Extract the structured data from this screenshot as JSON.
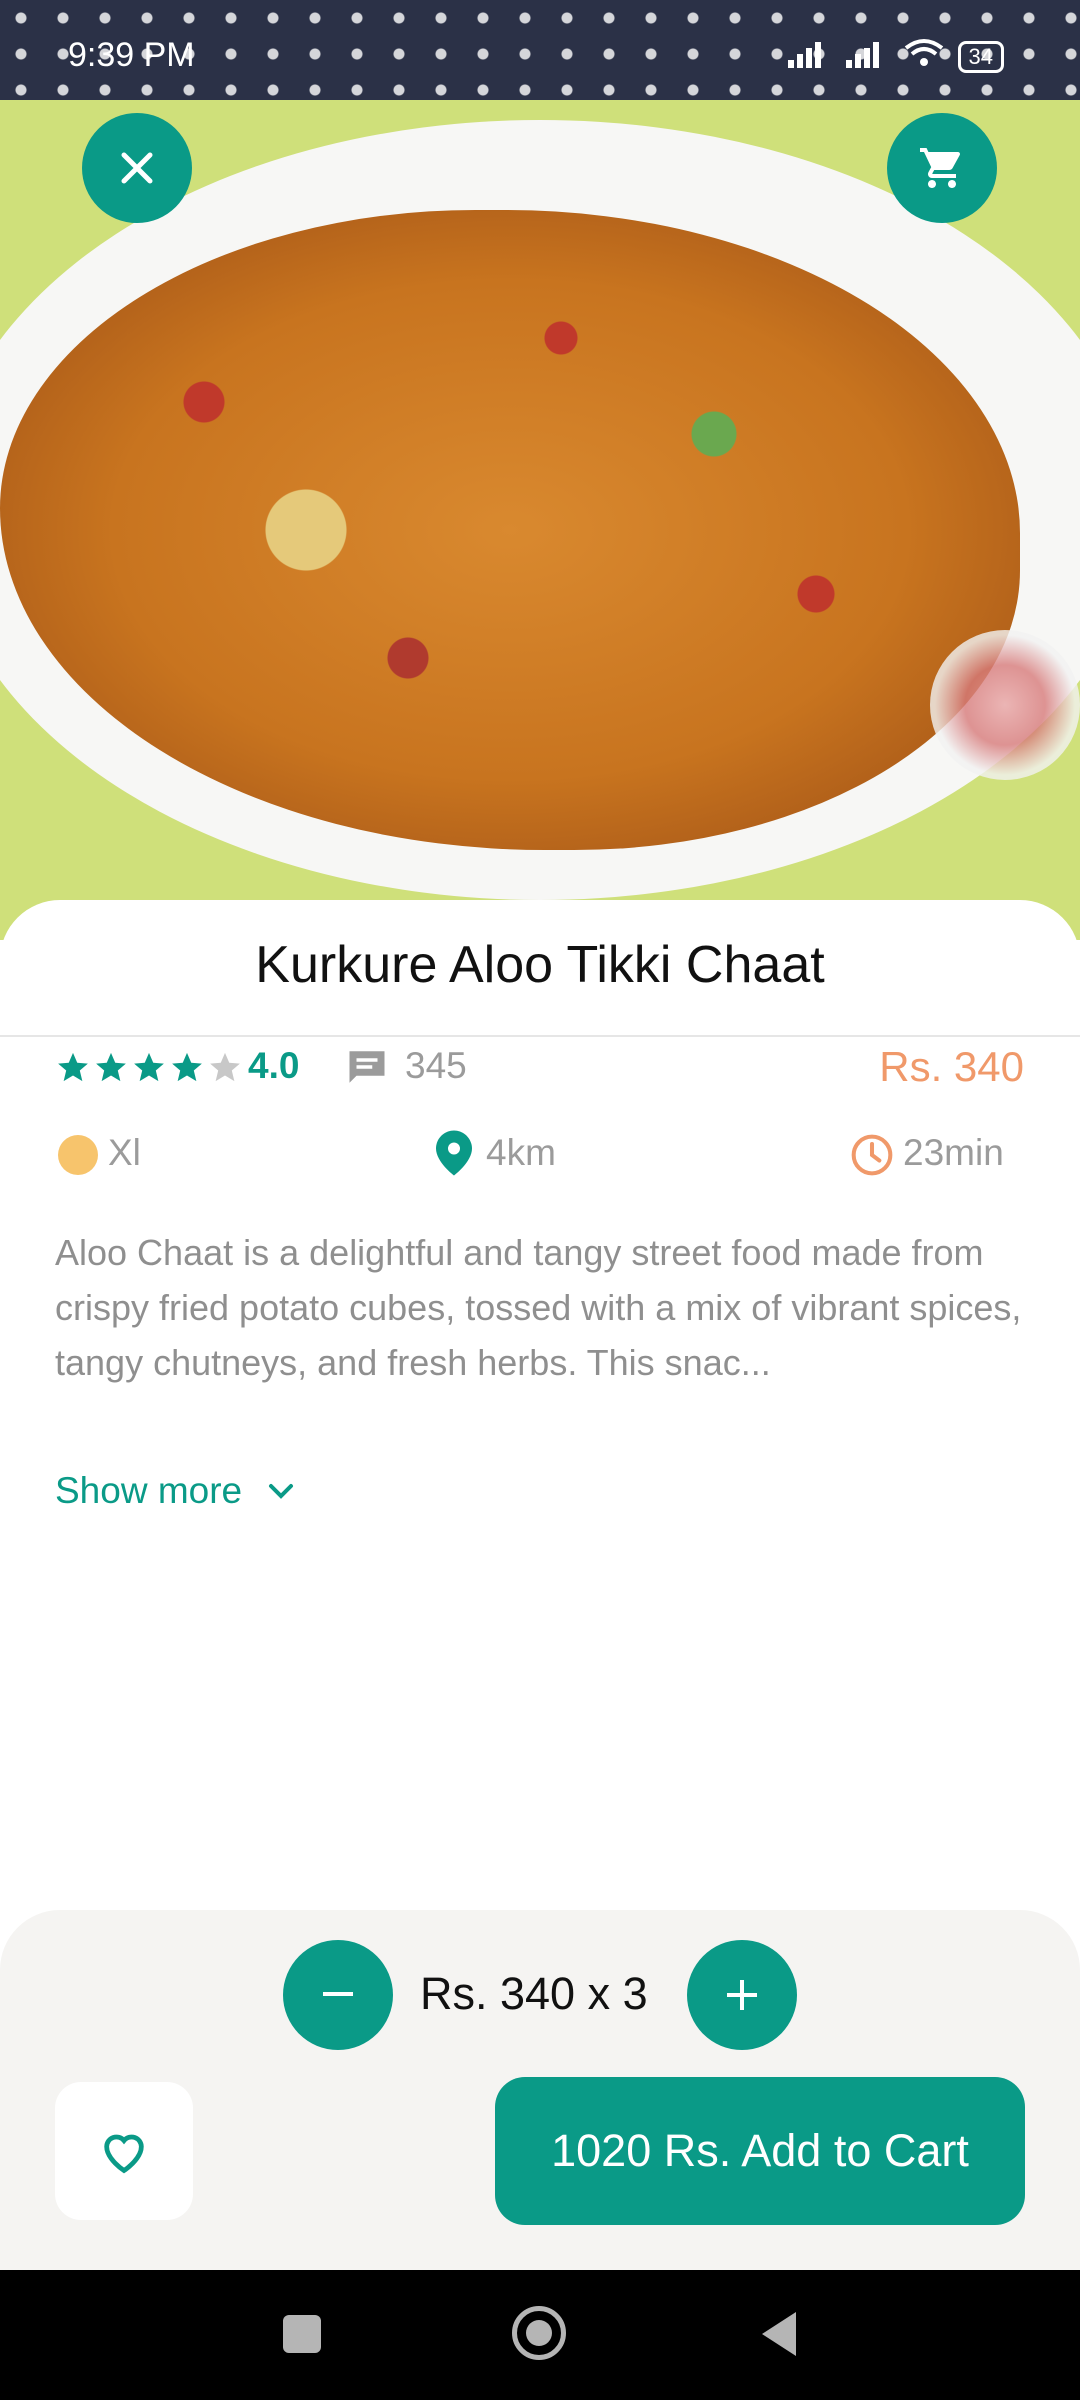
{
  "status_bar": {
    "time": "9:39 PM",
    "battery": "34"
  },
  "product": {
    "title": "Kurkure Aloo Tikki Chaat",
    "rating": "4.0",
    "rating_stars": 4,
    "reviews_count": "345",
    "price": "Rs. 340",
    "size": "Xl",
    "distance": "4km",
    "time": "23min",
    "description": "Aloo Chaat is a delightful and tangy street food made from crispy fried potato cubes, tossed with a mix of vibrant spices, tangy chutneys, and fresh herbs. This snac...",
    "show_more_label": "Show more"
  },
  "cart": {
    "quantity_label": "Rs. 340 x 3",
    "add_button_label": "1020 Rs. Add to Cart"
  },
  "colors": {
    "accent": "#0a9a87",
    "price": "#f0996a",
    "size_dot": "#f7c46c",
    "time_icon": "#f0996a"
  }
}
